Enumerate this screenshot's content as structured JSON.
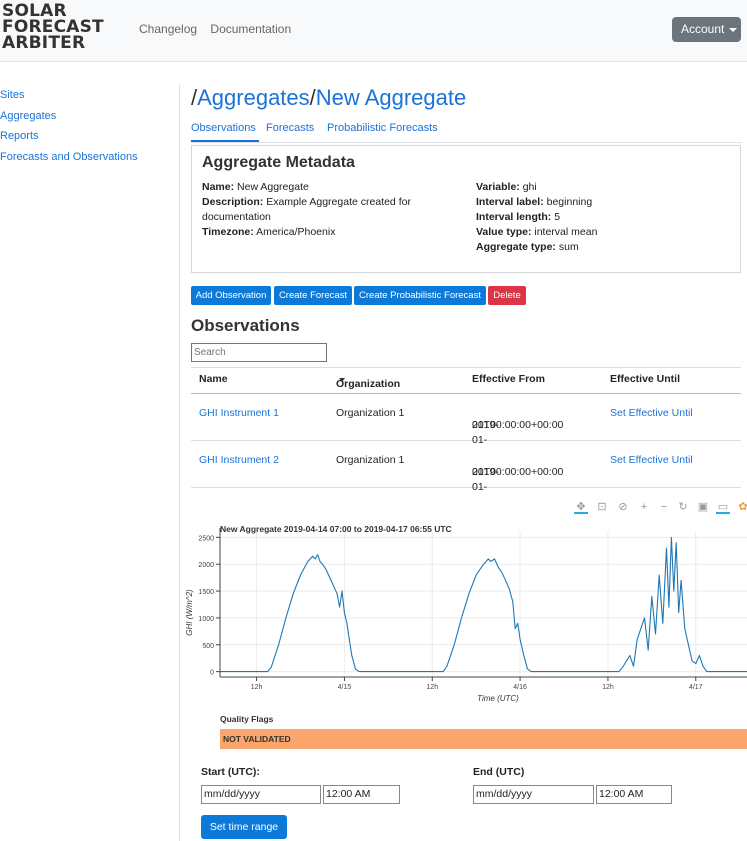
{
  "brand": {
    "line1": "SOLAR",
    "line2": "FORECAST",
    "line3": "ARBITER"
  },
  "nav": {
    "changelog": "Changelog",
    "documentation": "Documentation",
    "account": "Account"
  },
  "sidebar": {
    "items": [
      {
        "label": "Sites"
      },
      {
        "label": "Aggregates"
      },
      {
        "label": "Reports"
      },
      {
        "label": "Forecasts and Observations"
      }
    ]
  },
  "breadcrumb": {
    "sep1": "/",
    "aggregates": "Aggregates",
    "sep2": "/",
    "current": "New Aggregate"
  },
  "tabs": [
    {
      "label": "Observations"
    },
    {
      "label": "Forecasts"
    },
    {
      "label": "Probabilistic Forecasts"
    }
  ],
  "metadata": {
    "heading": "Aggregate Metadata",
    "name_label": "Name:",
    "name": "New Aggregate",
    "description_label": "Description:",
    "description": "Example Aggregate created for documentation",
    "timezone_label": "Timezone:",
    "timezone": "America/Phoenix",
    "variable_label": "Variable:",
    "variable": "ghi",
    "interval_label_label": "Interval label:",
    "interval_label": "beginning",
    "interval_length_label": "Interval length:",
    "interval_length": "5",
    "value_type_label": "Value type:",
    "value_type": "interval mean",
    "aggregate_type_label": "Aggregate type:",
    "aggregate_type": "sum"
  },
  "actions": {
    "add_observation": "Add Observation",
    "create_forecast": "Create Forecast",
    "create_prob_forecast": "Create Probabilistic Forecast",
    "delete": "Delete"
  },
  "observations": {
    "heading": "Observations",
    "search_placeholder": "Search",
    "columns": {
      "name": "Name",
      "organization": "Organization",
      "effective_from": "Effective From",
      "effective_until": "Effective Until"
    },
    "rows": [
      {
        "name": "GHI Instrument 1",
        "organization": "Organization 1",
        "from_line1": "2019-01-",
        "from_line2": "01T00:00:00+00:00",
        "until": "Set Effective Until"
      },
      {
        "name": "GHI Instrument 2",
        "organization": "Organization 1",
        "from_line1": "2019-01-",
        "from_line2": "01T00:00:00+00:00",
        "until": "Set Effective Until"
      }
    ]
  },
  "toolbar_icons": [
    "pan-icon",
    "box-zoom-icon",
    "wheel-zoom-icon",
    "zoom-in-icon",
    "zoom-out-icon",
    "reset-icon",
    "save-icon",
    "hover-icon",
    "bokeh-logo-icon"
  ],
  "chart_data": {
    "type": "line",
    "title": "New Aggregate 2019-04-14 07:00 to 2019-04-17 06:55 UTC",
    "xlabel": "Time (UTC)",
    "ylabel": "GHI (W/m^2)",
    "ylim": [
      -100,
      2600
    ],
    "yticks": [
      0,
      500,
      1000,
      1500,
      2000,
      2500
    ],
    "xlim": [
      "2019-04-14 07:00",
      "2019-04-17 07:00"
    ],
    "xticks": [
      {
        "t": "2019-04-14 12:00",
        "label": "12h"
      },
      {
        "t": "2019-04-15 00:00",
        "label": "4/15"
      },
      {
        "t": "2019-04-15 12:00",
        "label": "12h"
      },
      {
        "t": "2019-04-16 00:00",
        "label": "4/16"
      },
      {
        "t": "2019-04-16 12:00",
        "label": "12h"
      },
      {
        "t": "2019-04-17 00:00",
        "label": "4/17"
      }
    ],
    "series": [
      {
        "color": "#1f77b4",
        "points": [
          [
            "2019-04-14 07:00",
            0
          ],
          [
            "2019-04-14 12:00",
            0
          ],
          [
            "2019-04-14 13:30",
            0
          ],
          [
            "2019-04-14 14:00",
            80
          ],
          [
            "2019-04-14 15:00",
            500
          ],
          [
            "2019-04-14 16:00",
            1000
          ],
          [
            "2019-04-14 17:00",
            1450
          ],
          [
            "2019-04-14 18:00",
            1800
          ],
          [
            "2019-04-14 19:00",
            2050
          ],
          [
            "2019-04-14 19:40",
            2150
          ],
          [
            "2019-04-14 20:00",
            2100
          ],
          [
            "2019-04-14 20:20",
            2180
          ],
          [
            "2019-04-14 20:40",
            2050
          ],
          [
            "2019-04-14 21:00",
            2000
          ],
          [
            "2019-04-14 21:30",
            1900
          ],
          [
            "2019-04-14 22:00",
            1750
          ],
          [
            "2019-04-14 22:30",
            1600
          ],
          [
            "2019-04-14 23:00",
            1450
          ],
          [
            "2019-04-14 23:20",
            1200
          ],
          [
            "2019-04-14 23:40",
            1500
          ],
          [
            "2019-04-15 00:00",
            1100
          ],
          [
            "2019-04-15 00:20",
            900
          ],
          [
            "2019-04-15 00:40",
            600
          ],
          [
            "2019-04-15 01:00",
            300
          ],
          [
            "2019-04-15 01:30",
            50
          ],
          [
            "2019-04-15 02:00",
            0
          ],
          [
            "2019-04-15 13:30",
            0
          ],
          [
            "2019-04-15 14:00",
            100
          ],
          [
            "2019-04-15 15:00",
            500
          ],
          [
            "2019-04-15 16:00",
            1000
          ],
          [
            "2019-04-15 17:00",
            1450
          ],
          [
            "2019-04-15 18:00",
            1800
          ],
          [
            "2019-04-15 19:00",
            2000
          ],
          [
            "2019-04-15 19:40",
            2100
          ],
          [
            "2019-04-15 20:00",
            2050
          ],
          [
            "2019-04-15 20:30",
            2100
          ],
          [
            "2019-04-15 21:00",
            1950
          ],
          [
            "2019-04-15 21:30",
            1850
          ],
          [
            "2019-04-15 22:00",
            1700
          ],
          [
            "2019-04-15 22:30",
            1550
          ],
          [
            "2019-04-15 23:00",
            1300
          ],
          [
            "2019-04-15 23:20",
            800
          ],
          [
            "2019-04-15 23:40",
            900
          ],
          [
            "2019-04-16 00:00",
            600
          ],
          [
            "2019-04-16 00:30",
            300
          ],
          [
            "2019-04-16 01:00",
            50
          ],
          [
            "2019-04-16 01:30",
            0
          ],
          [
            "2019-04-16 13:30",
            0
          ],
          [
            "2019-04-16 14:00",
            80
          ],
          [
            "2019-04-16 15:00",
            300
          ],
          [
            "2019-04-16 15:30",
            100
          ],
          [
            "2019-04-16 16:00",
            600
          ],
          [
            "2019-04-16 17:00",
            1000
          ],
          [
            "2019-04-16 17:30",
            400
          ],
          [
            "2019-04-16 18:00",
            1400
          ],
          [
            "2019-04-16 18:30",
            700
          ],
          [
            "2019-04-16 19:00",
            1800
          ],
          [
            "2019-04-16 19:30",
            900
          ],
          [
            "2019-04-16 20:00",
            2300
          ],
          [
            "2019-04-16 20:20",
            1200
          ],
          [
            "2019-04-16 20:40",
            2500
          ],
          [
            "2019-04-16 21:00",
            1500
          ],
          [
            "2019-04-16 21:20",
            2400
          ],
          [
            "2019-04-16 21:40",
            1100
          ],
          [
            "2019-04-16 22:00",
            1700
          ],
          [
            "2019-04-16 22:30",
            800
          ],
          [
            "2019-04-16 23:00",
            500
          ],
          [
            "2019-04-16 23:30",
            200
          ],
          [
            "2019-04-17 00:00",
            150
          ],
          [
            "2019-04-17 00:30",
            300
          ],
          [
            "2019-04-17 01:00",
            100
          ],
          [
            "2019-04-17 01:30",
            0
          ],
          [
            "2019-04-17 07:00",
            0
          ]
        ]
      }
    ],
    "grid": true
  },
  "quality": {
    "label": "Quality Flags",
    "bar_text": "NOT VALIDATED",
    "bar_color": "#f9a56b"
  },
  "time_range": {
    "start_label": "Start (UTC):",
    "start_date": "mm/dd/yyyy",
    "start_time": "12:00 AM",
    "end_label": "End (UTC)",
    "end_date": "mm/dd/yyyy",
    "end_time": "12:00 AM",
    "button": "Set time range"
  }
}
